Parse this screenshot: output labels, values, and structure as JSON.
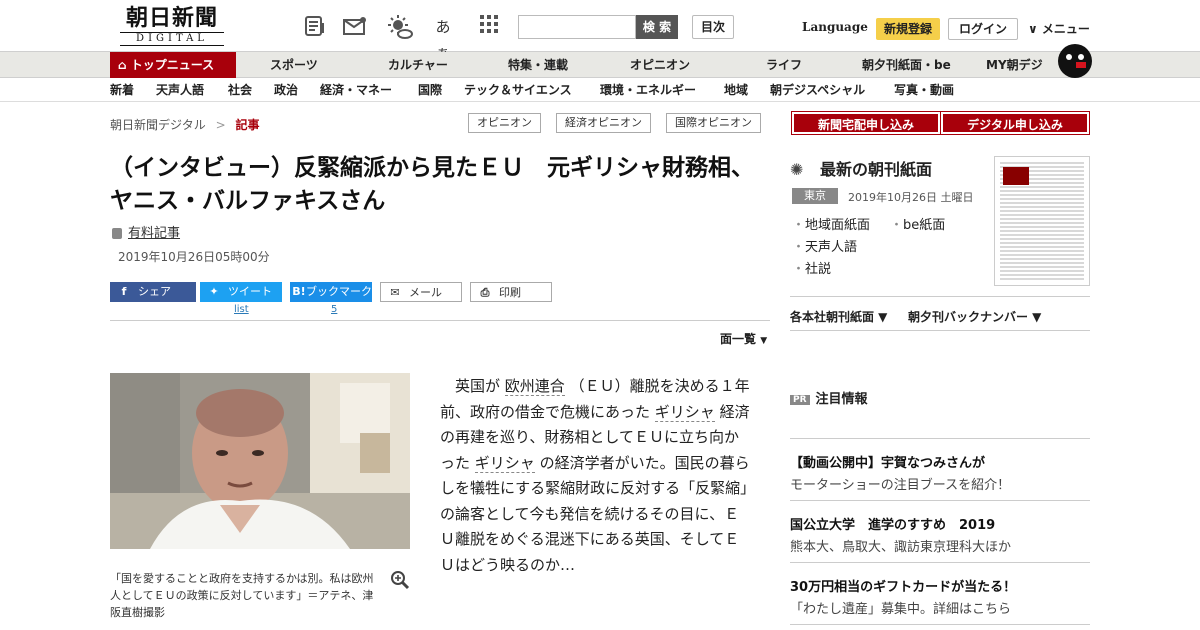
{
  "header": {
    "logo_jp": "朝日新聞",
    "logo_en": "DIGITAL",
    "icons": [
      "newspaper-icon",
      "mail-icon",
      "weather-icon",
      "font-size-icon",
      "grid-icon"
    ],
    "font_size_label": "あぁ",
    "search_placeholder": "",
    "search_label": "検 索",
    "toc_label": "目次",
    "language_label": "Language",
    "register_label": "新規登録",
    "login_label": "ログイン",
    "menu_label": "∨ メニュー"
  },
  "nav_primary": [
    "トップニュース",
    "スポーツ",
    "カルチャー",
    "特集・連載",
    "オピニオン",
    "ライフ",
    "朝夕刊紙面・be",
    "MY朝デジ"
  ],
  "nav_secondary": [
    "新着",
    "天声人語",
    "社会",
    "政治",
    "経済・マネー",
    "国際",
    "テック＆サイエンス",
    "環境・エネルギー",
    "地域",
    "朝デジスペシャル",
    "写真・動画"
  ],
  "breadcrumb": {
    "home": "朝日新聞デジタル",
    "sep": ">",
    "current": "記事"
  },
  "tags": [
    "オピニオン",
    "経済オピニオン",
    "国際オピニオン"
  ],
  "article": {
    "title": "（インタビュー）反緊縮派から見たＥＵ　元ギリシャ財務相、ヤニス・バルファキスさん",
    "paid_label": "有料記事",
    "date": "2019年10月26日05時00分",
    "share": {
      "facebook": "シェア",
      "twitter": "ツイート",
      "hatena": "ブックマーク",
      "mail": "メール",
      "print": "印刷",
      "twitter_count": "list",
      "hatena_count": "5"
    },
    "pages_label": "面一覧",
    "caption": "「国を愛することと政府を支持するかは別。私は欧州人としてＥＵの政策に反対しています」＝アテネ、津阪直樹撮影",
    "body_1": "英国が",
    "link_eu": "欧州連合",
    "body_2": "（ＥＵ）離脱を決める１年前、政府の借金で危機にあった",
    "link_greece1": "ギリシャ",
    "body_3": "経済の再建を巡り、財務相としてＥＵに立ち向かった",
    "link_greece2": "ギリシャ",
    "body_4": "の経済学者がいた。国民の暮らしを犠牲にする緊縮財政に反対する「反緊縮」の論客として今も発信を続けるその目に、ＥＵ離脱をめぐる混迷下にある英国、そしてＥＵはどう映るのか…"
  },
  "sidebar": {
    "buttons": [
      "新聞宅配申し込み",
      "デジタル申し込み"
    ],
    "morning_title": "最新の朝刊紙面",
    "region": "東京",
    "morning_date": "2019年10月26日 土曜日",
    "links": [
      "地域面紙面",
      "be紙面",
      "天声人語",
      "社説"
    ],
    "archive_links": [
      "各本社朝刊紙面 ▼",
      "朝夕刊バックナンバー ▼"
    ],
    "pr_badge": "PR",
    "pr_title": "注目情報",
    "ads": [
      {
        "title": "【動画公開中】宇賀なつみさんが",
        "sub": "モーターショーの注目ブースを紹介！"
      },
      {
        "title": "国公立大学　進学のすすめ　2019",
        "sub": "熊本大、鳥取大、諏訪東京理科大ほか"
      },
      {
        "title": "30万円相当のギフトカードが当たる！",
        "sub": "「わたし遺産」募集中。詳細はこちら"
      }
    ]
  },
  "colors": {
    "brand": "#a8000b",
    "register": "#f5cf4a",
    "facebook": "#3b5998",
    "twitter": "#1da1f2",
    "hatena": "#1a8ee8"
  }
}
